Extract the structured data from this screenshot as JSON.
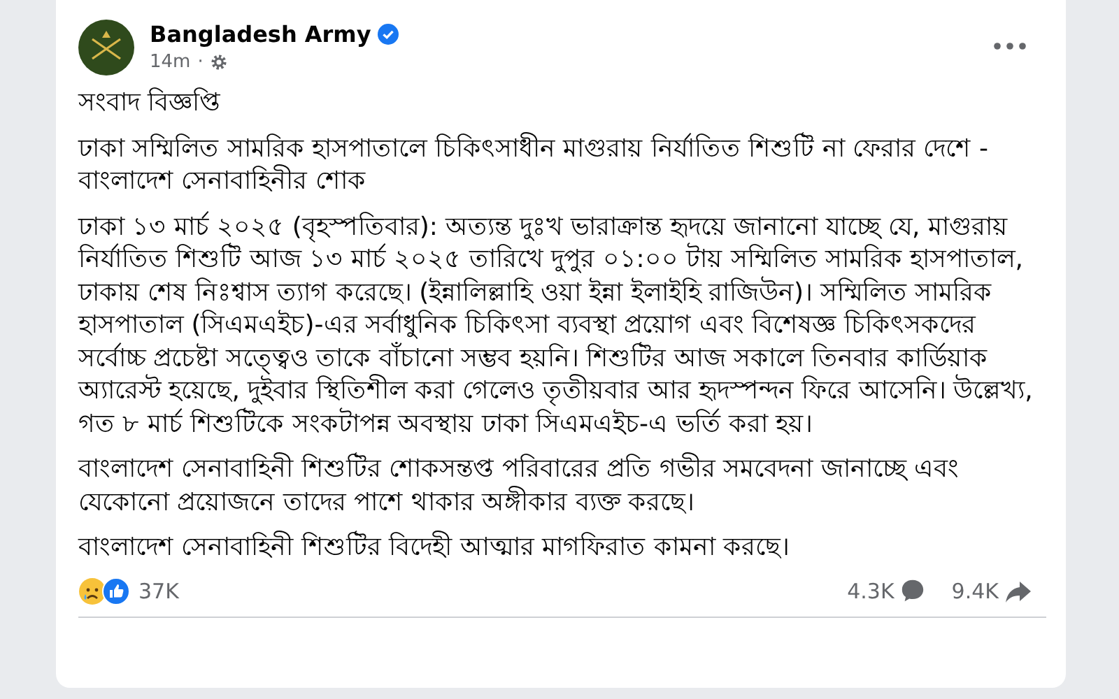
{
  "post": {
    "author": "Bangladesh Army",
    "time": "14m",
    "separator": "·",
    "paragraphs": [
      "সংবাদ বিজ্ঞপ্তি",
      "ঢাকা সম্মিলিত সামরিক হাসপাতালে চিকিৎসাধীন মাগুরায় নির্যাতিত শিশুটি না ফেরার দেশে - বাংলাদেশ সেনাবাহিনীর শোক",
      "ঢাকা ১৩ মার্চ ২০২৫ (বৃহস্পতিবার): অত্যন্ত দুঃখ ভারাক্রান্ত হৃদয়ে জানানো যাচ্ছে যে, মাগুরায় নির্যাতিত শিশুটি আজ ১৩ মার্চ ২০২৫ তারিখে দুপুর ০১:০০ টায় সম্মিলিত সামরিক হাসপাতাল, ঢাকায় শেষ নিঃশ্বাস ত্যাগ করেছে। (ইন্নালিল্লাহি ওয়া ইন্না ইলাইহি রাজিউন)। সম্মিলিত সামরিক হাসপাতাল (সিএমএইচ)-এর সর্বাধুনিক চিকিৎসা ব্যবস্থা প্রয়োগ এবং বিশেষজ্ঞ চিকিৎসকদের সর্বোচ্চ প্রচেষ্টা সত্ত্বেও তাকে বাঁচানো সম্ভব হয়নি। শিশুটির আজ সকালে তিনবার কার্ডিয়াক অ্যারেস্ট হয়েছে, দুইবার স্থিতিশীল করা গেলেও তৃতীয়বার আর হৃদস্পন্দন ফিরে আসেনি। উল্লেখ্য, গত ৮ মার্চ শিশুটিকে সংকটাপন্ন অবস্থায় ঢাকা সিএমএইচ-এ ভর্তি করা হয়।",
      "বাংলাদেশ সেনাবাহিনী শিশুটির শোকসন্তপ্ত পরিবারের প্রতি গভীর সমবেদনা জানাচ্ছে এবং যেকোনো প্রয়োজনে তাদের পাশে থাকার অঙ্গীকার ব্যক্ত করছে।",
      "বাংলাদেশ সেনাবাহিনী শিশুটির বিদেহী আত্মার মাগফিরাত কামনা করছে।"
    ],
    "reactions": "37K",
    "comments": "4.3K",
    "shares": "9.4K"
  }
}
